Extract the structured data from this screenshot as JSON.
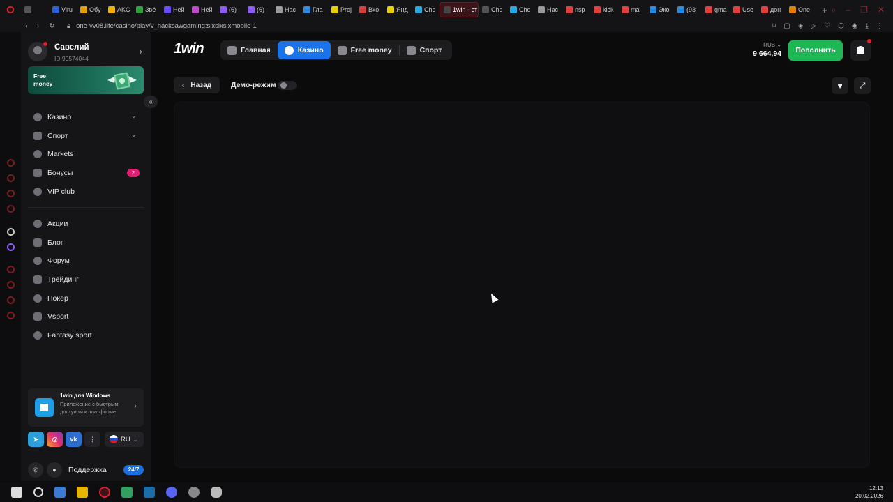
{
  "browser": {
    "tabs": [
      {
        "label": "",
        "color": "#555"
      },
      {
        "label": "Viru",
        "color": "#2f5fd0"
      },
      {
        "label": "Обу",
        "color": "#e0a000"
      },
      {
        "label": "AKC",
        "color": "#f0b000"
      },
      {
        "label": "Звё",
        "color": "#2fa040"
      },
      {
        "label": "Ней",
        "color": "#6d4cff"
      },
      {
        "label": "Ней",
        "color": "#c04cc8"
      },
      {
        "label": "(6)",
        "color": "#8b5cf6"
      },
      {
        "label": "(6)",
        "color": "#8b5cf6"
      },
      {
        "label": "Нас",
        "color": "#999"
      },
      {
        "label": "Гла",
        "color": "#2f8ae0"
      },
      {
        "label": "Proj",
        "color": "#e8d000"
      },
      {
        "label": "Вхо",
        "color": "#d04040"
      },
      {
        "label": "Янд",
        "color": "#e8d000"
      },
      {
        "label": "Che",
        "color": "#2aa8e0"
      },
      {
        "label": "1win - ст",
        "color": "#444",
        "active": true
      },
      {
        "label": "Che",
        "color": "#555"
      },
      {
        "label": "Che",
        "color": "#2aa8e0"
      },
      {
        "label": "Нас",
        "color": "#999"
      },
      {
        "label": "nsp",
        "color": "#e04040"
      },
      {
        "label": "kick",
        "color": "#e04040"
      },
      {
        "label": "mai",
        "color": "#e04040"
      },
      {
        "label": "Эко",
        "color": "#2a8ae0"
      },
      {
        "label": "(93",
        "color": "#2a8ae0"
      },
      {
        "label": "gma",
        "color": "#e04040"
      },
      {
        "label": "Use",
        "color": "#e04040"
      },
      {
        "label": "дон",
        "color": "#e04040"
      },
      {
        "label": "One",
        "color": "#e08000"
      }
    ],
    "new_tab": "+",
    "url": "one-vv08.life/casino/play/v_hacksawgaming:sixsixsixmobile-1"
  },
  "sidebar": {
    "user_name": "Савелий",
    "user_id": "ID 90574044",
    "promo_text": "Free money",
    "menu_main": [
      {
        "label": "Казино",
        "chevron": true
      },
      {
        "label": "Спорт",
        "chevron": true
      },
      {
        "label": "Markets"
      },
      {
        "label": "Бонусы",
        "badge": "2"
      },
      {
        "label": "VIP club"
      }
    ],
    "menu_secondary": [
      {
        "label": "Акции"
      },
      {
        "label": "Блог"
      },
      {
        "label": "Форум"
      },
      {
        "label": "Трейдинг"
      },
      {
        "label": "Покер"
      },
      {
        "label": "Vsport"
      },
      {
        "label": "Fantasy sport"
      }
    ],
    "app_card": {
      "title": "1win для Windows",
      "desc": "Приложение с быстрым доступом к платформе"
    },
    "lang": "RU",
    "support_label": "Поддержка",
    "support_badge": "24/7"
  },
  "header": {
    "logo": "1win",
    "nav": [
      {
        "label": "Главная"
      },
      {
        "label": "Казино",
        "active": true
      },
      {
        "label": "Free money"
      },
      {
        "label": "Спорт"
      }
    ],
    "currency": "RUB",
    "balance": "9 664,94",
    "deposit_label": "Пополнить"
  },
  "game": {
    "back_label": "Назад",
    "demo_label": "Демо-режим",
    "demo_on": false
  },
  "taskbar": {
    "time": "12:13",
    "date": "20.02.2026"
  }
}
